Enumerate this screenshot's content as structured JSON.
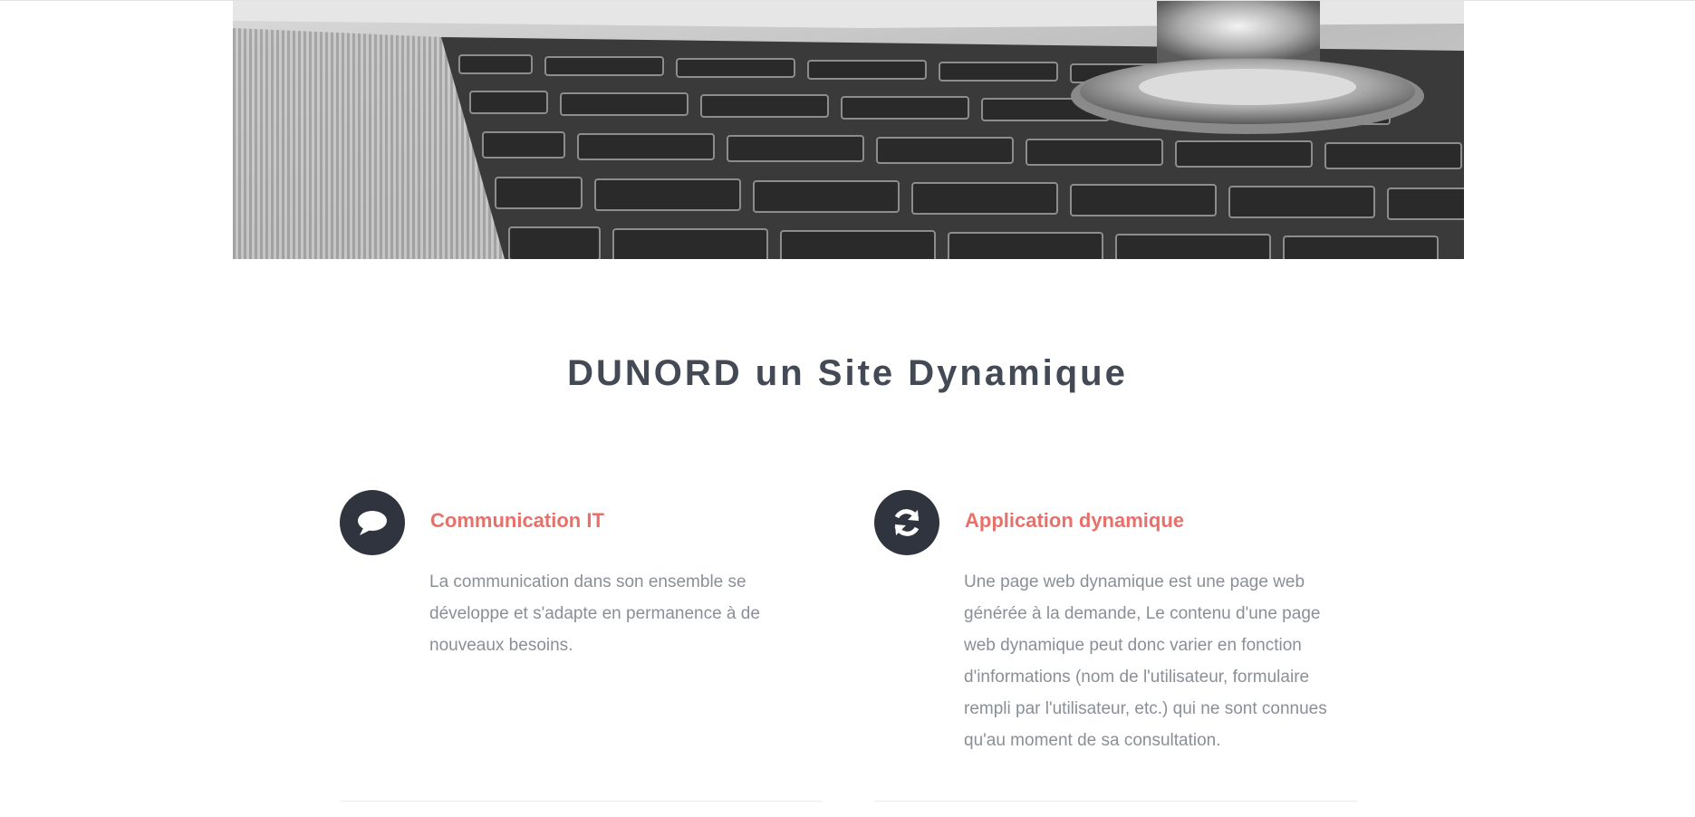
{
  "hero": {
    "image_description_icon": "keyboard-stethoscope-photo"
  },
  "section": {
    "title": "DUNORD un Site Dynamique"
  },
  "features": [
    {
      "icon": "speech-bubble-icon",
      "title": "Communication IT",
      "text": "La communication dans son ensemble se développe et s'adapte en permanence à de nouveaux besoins."
    },
    {
      "icon": "refresh-icon",
      "title": "Application dynamique",
      "text": "Une page web dynamique est une page web générée à la demande, Le contenu d'une page web dynamique peut donc varier en fonction d'informations (nom de l'utilisateur, formulaire rempli par l'utilisateur, etc.) qui ne sont connues qu'au moment de sa consultation."
    }
  ],
  "colors": {
    "accent": "#e8706a",
    "icon_bg": "#2f343e",
    "title": "#444a55",
    "body_text": "#8a8f97"
  }
}
